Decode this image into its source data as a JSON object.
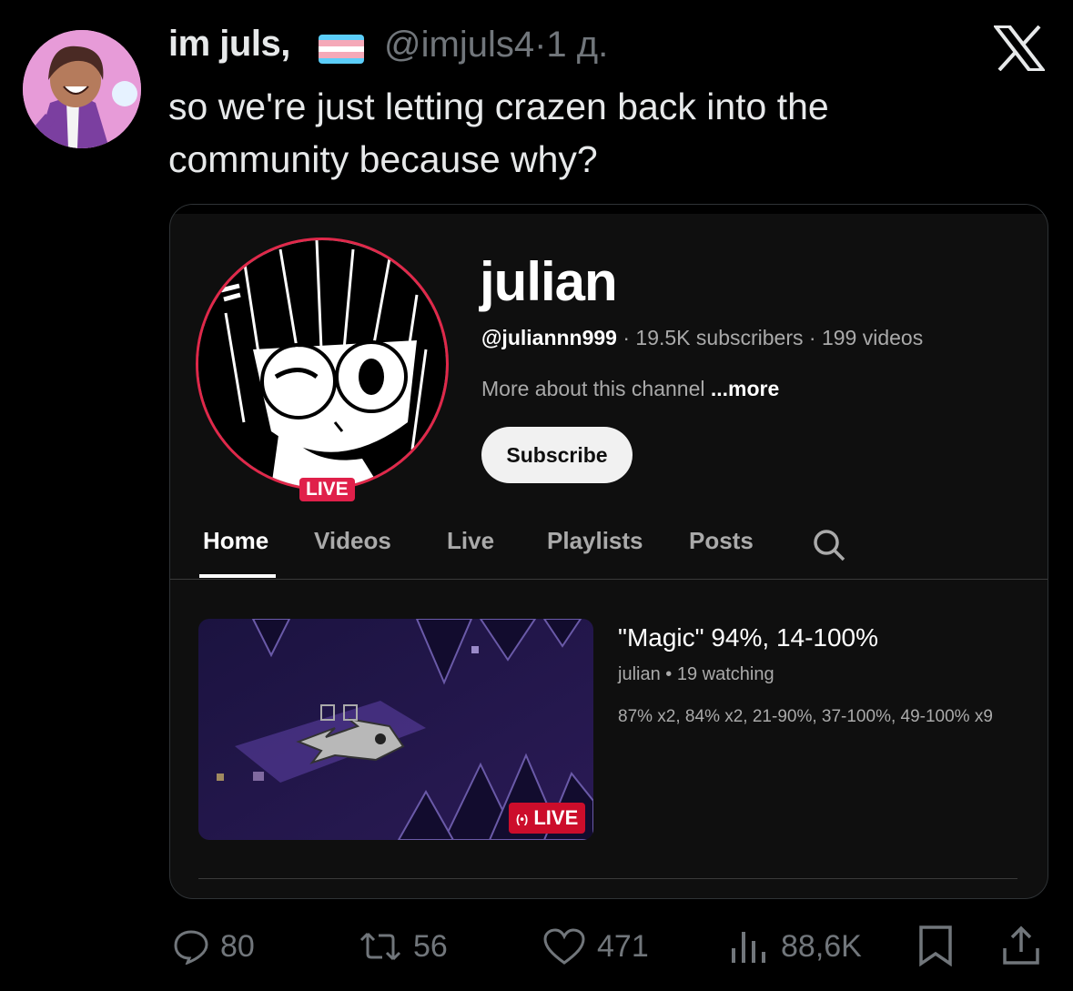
{
  "tweet": {
    "display_name": "im juls,",
    "handle": "@imjuls4",
    "separator": "·",
    "time": "1 д.",
    "text": "so we're just letting crazen back into the community because why?",
    "flag_colors": [
      "#5bcefa",
      "#f5a9b8",
      "#ffffff",
      "#f5a9b8",
      "#5bcefa"
    ]
  },
  "channel": {
    "name": "julian",
    "handle": "@juliannn999",
    "subscribers": "19.5K subscribers",
    "videos": "199 videos",
    "dot": " · ",
    "about": "More about this channel",
    "more": " ...more",
    "subscribe_label": "Subscribe",
    "avatar_live": "LIVE",
    "accent_live": "#e0204a",
    "tabs": [
      {
        "label": "Home",
        "active": true
      },
      {
        "label": "Videos"
      },
      {
        "label": "Live"
      },
      {
        "label": "Playlists"
      },
      {
        "label": "Posts"
      }
    ]
  },
  "video": {
    "title": "\"Magic\" 94%, 14-100%",
    "channel": "julian",
    "bullet": " • ",
    "watching": "19 watching",
    "description": "87% x2, 84% x2, 21-90%, 37-100%, 49-100% x9",
    "live_label": "LIVE",
    "live_icon": "(•)"
  },
  "actions": {
    "replies": "80",
    "reposts": "56",
    "likes": "471",
    "views": "88,6K"
  }
}
